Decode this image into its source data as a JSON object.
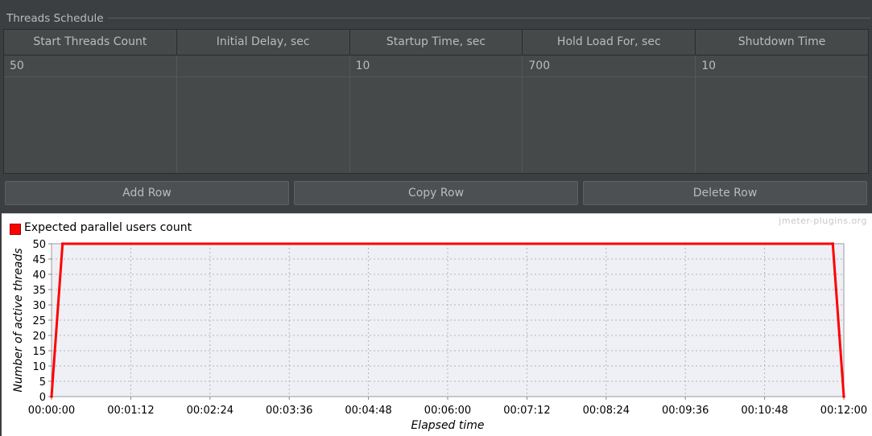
{
  "panel": {
    "title": "Threads Schedule"
  },
  "table": {
    "columns": [
      "Start Threads Count",
      "Initial Delay, sec",
      "Startup Time, sec",
      "Hold Load For, sec",
      "Shutdown Time"
    ],
    "rows": [
      [
        "50",
        "",
        "10",
        "700",
        "10"
      ]
    ]
  },
  "buttons": {
    "add": "Add Row",
    "copy": "Copy Row",
    "delete": "Delete Row"
  },
  "watermark": "jmeter-plugins.org",
  "colors": {
    "series": "#ff0000",
    "plot_bg": "#eef0f5",
    "panel_bg": "#3c3f41"
  },
  "chart_data": {
    "type": "line",
    "legend": "Expected parallel users count",
    "legend_position": "top-left",
    "xlabel": "Elapsed time",
    "ylabel": "Number of active threads",
    "grid": true,
    "ylim": [
      0,
      50
    ],
    "xlim_seconds": [
      0,
      720
    ],
    "y_ticks": [
      "0",
      "5",
      "10",
      "15",
      "20",
      "25",
      "30",
      "35",
      "40",
      "45",
      "50"
    ],
    "x_ticks": [
      "00:00:00",
      "00:01:12",
      "00:02:24",
      "00:03:36",
      "00:04:48",
      "00:06:00",
      "00:07:12",
      "00:08:24",
      "00:09:36",
      "00:10:48",
      "00:12:00"
    ],
    "series": [
      {
        "name": "Expected parallel users count",
        "x_seconds": [
          0,
          10,
          710,
          720
        ],
        "y": [
          0,
          50,
          50,
          0
        ]
      }
    ]
  }
}
